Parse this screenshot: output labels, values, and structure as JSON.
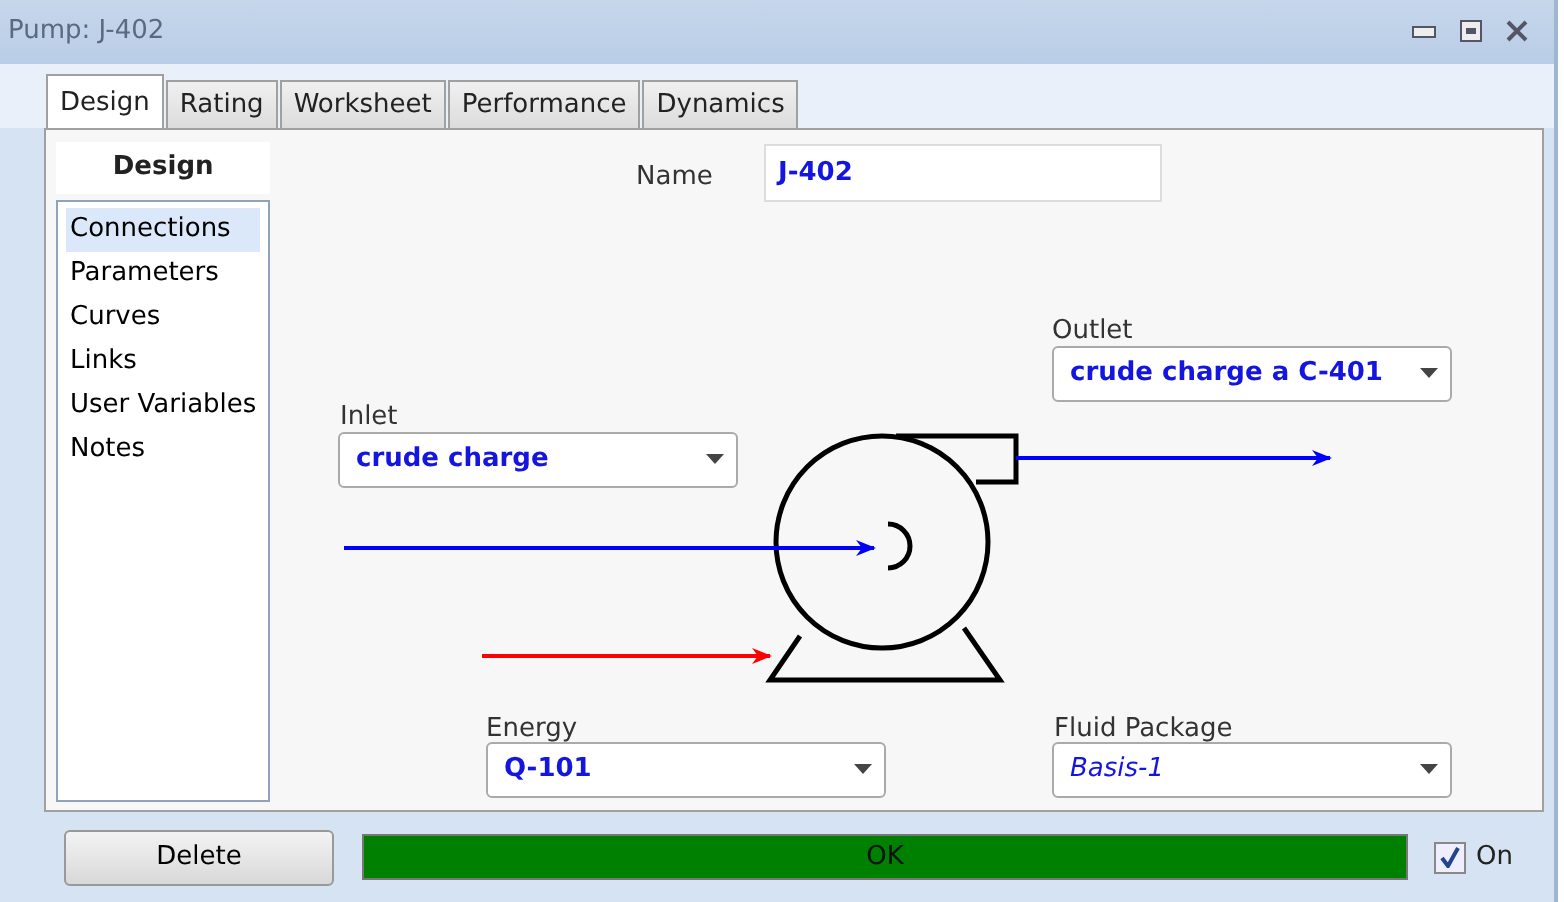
{
  "window": {
    "title": "Pump: J-402"
  },
  "tabs": [
    {
      "label": "Design",
      "selected": true
    },
    {
      "label": "Rating",
      "selected": false
    },
    {
      "label": "Worksheet",
      "selected": false
    },
    {
      "label": "Performance",
      "selected": false
    },
    {
      "label": "Dynamics",
      "selected": false
    }
  ],
  "sidebar": {
    "title": "Design",
    "items": [
      {
        "label": "Connections",
        "selected": true
      },
      {
        "label": "Parameters",
        "selected": false
      },
      {
        "label": "Curves",
        "selected": false
      },
      {
        "label": "Links",
        "selected": false
      },
      {
        "label": "User Variables",
        "selected": false
      },
      {
        "label": "Notes",
        "selected": false
      }
    ]
  },
  "name": {
    "label": "Name",
    "value": "J-402"
  },
  "connections": [
    {
      "kind": "outlet",
      "label": "Outlet",
      "value": "crude charge a C-401"
    },
    {
      "kind": "inlet",
      "label": "Inlet",
      "value": "crude charge"
    },
    {
      "kind": "energy",
      "label": "Energy",
      "value": "Q-101"
    },
    {
      "kind": "fluid",
      "label": "Fluid Package",
      "value": "Basis-1"
    }
  ],
  "delete_button": "Delete",
  "status": {
    "text": "OK"
  },
  "active": {
    "label": "On",
    "checked": true
  }
}
